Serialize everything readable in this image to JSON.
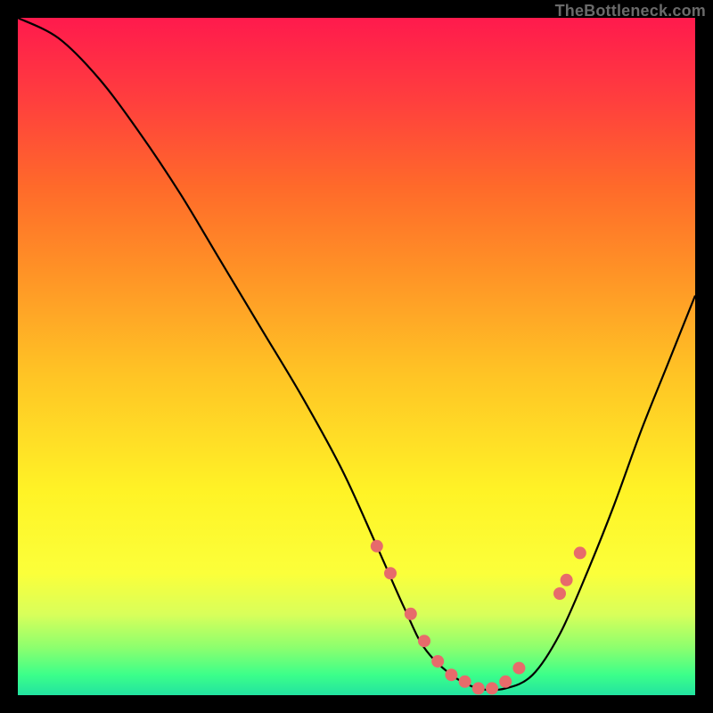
{
  "watermark": "TheBottleneck.com",
  "chart_data": {
    "type": "line",
    "title": "",
    "xlabel": "",
    "ylabel": "",
    "xlim": [
      0,
      100
    ],
    "ylim": [
      0,
      100
    ],
    "grid": false,
    "series": [
      {
        "name": "bottleneck-curve",
        "x": [
          0,
          6,
          12,
          18,
          24,
          30,
          36,
          42,
          48,
          53,
          57,
          60,
          64,
          68,
          72,
          76,
          80,
          84,
          88,
          92,
          96,
          100
        ],
        "y": [
          100,
          97,
          91,
          83,
          74,
          64,
          54,
          44,
          33,
          22,
          13,
          7,
          3,
          1,
          1,
          3,
          9,
          18,
          28,
          39,
          49,
          59
        ]
      }
    ],
    "points_overlay": {
      "name": "highlight-dots",
      "color": "#e76b6b",
      "x": [
        53,
        55,
        58,
        60,
        62,
        64,
        66,
        68,
        70,
        72,
        74,
        80,
        81,
        83
      ],
      "y": [
        22,
        18,
        12,
        8,
        5,
        3,
        2,
        1,
        1,
        2,
        4,
        15,
        17,
        21
      ]
    },
    "background_gradient": {
      "top": "#ff1a4d",
      "mid": "#ffe426",
      "bottom": "#22e3a0"
    }
  }
}
